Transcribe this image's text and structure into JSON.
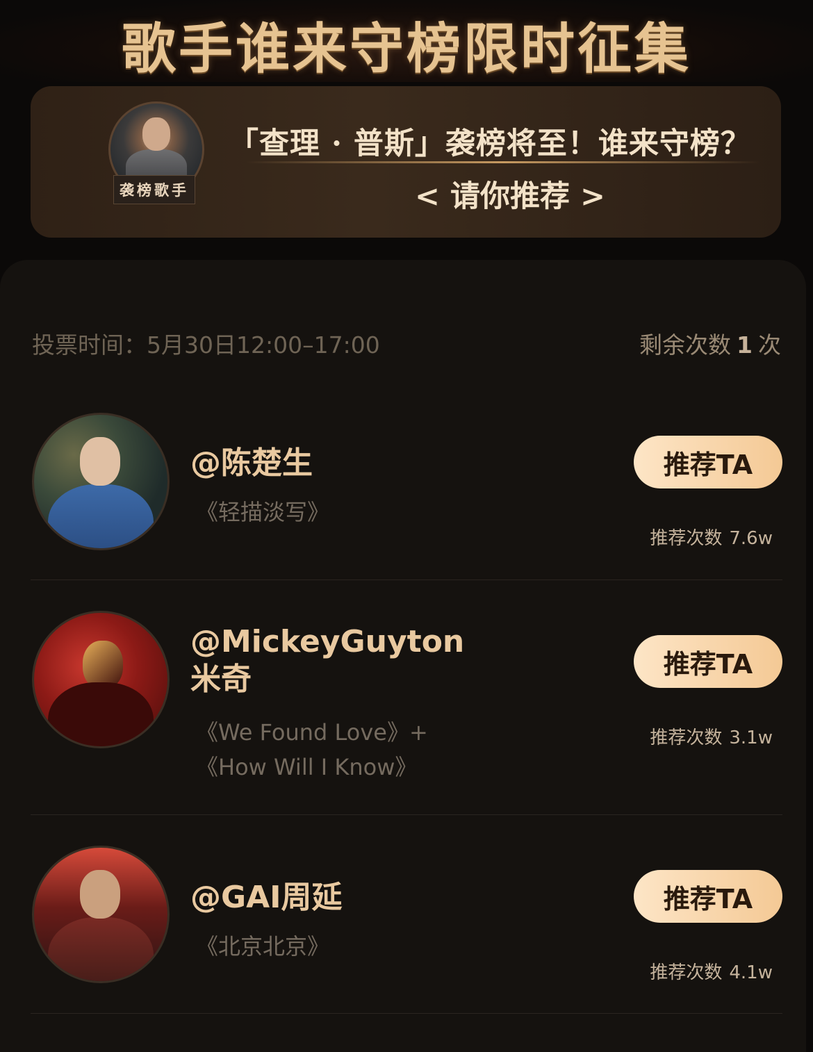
{
  "header": {
    "title": "歌手谁来守榜限时征集"
  },
  "invite": {
    "headline": "「查理 · 普斯」袭榜将至！谁来守榜？",
    "cta": "< 请你推荐 >",
    "badge": "袭榜歌手"
  },
  "vote": {
    "time": "投票时间：5月30日12:00–17:00",
    "remaining_label": "剩余次数",
    "remaining_count": "1",
    "remaining_unit": "次"
  },
  "candidates": [
    {
      "name": "@陈楚生",
      "songs": [
        "《轻描淡写》"
      ],
      "button": "推荐TA",
      "count_label": "推荐次数",
      "count": "7.6w"
    },
    {
      "name": "@MickeyGuyton米奇",
      "name_lines": [
        "@MickeyGuyton",
        "米奇"
      ],
      "songs": [
        "《We Found Love》+",
        "《How Will I Know》"
      ],
      "button": "推荐TA",
      "count_label": "推荐次数",
      "count": "3.1w"
    },
    {
      "name": "@GAI周延",
      "songs": [
        "《北京北京》"
      ],
      "button": "推荐TA",
      "count_label": "推荐次数",
      "count": "4.1w"
    }
  ],
  "colors": {
    "accent": "#f4c995",
    "name": "#e9c9a0",
    "background": "#15120f"
  }
}
